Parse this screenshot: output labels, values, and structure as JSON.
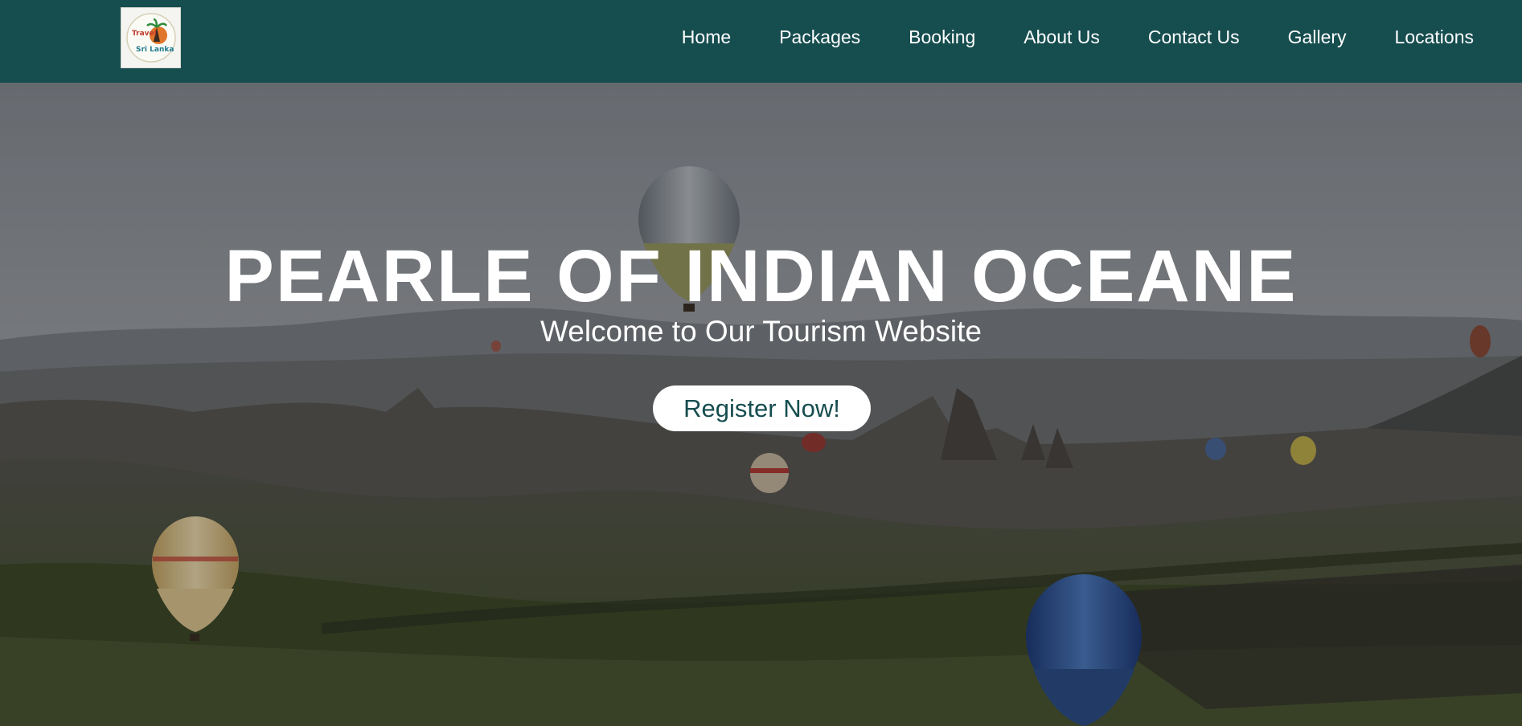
{
  "header": {
    "logo": {
      "text_top": "Travel",
      "text_bottom": "Sri Lanka"
    },
    "nav": [
      {
        "label": "Home"
      },
      {
        "label": "Packages"
      },
      {
        "label": "Booking"
      },
      {
        "label": "About Us"
      },
      {
        "label": "Contact Us"
      },
      {
        "label": "Gallery"
      },
      {
        "label": "Locations"
      }
    ]
  },
  "hero": {
    "title": "PEARLE OF INDIAN OCEANE",
    "subtitle": "Welcome to Our Tourism Website",
    "cta_label": "Register Now!"
  },
  "colors": {
    "nav_bg": "#164d4f",
    "button_bg": "#ffffff",
    "button_text": "#164d4f"
  }
}
